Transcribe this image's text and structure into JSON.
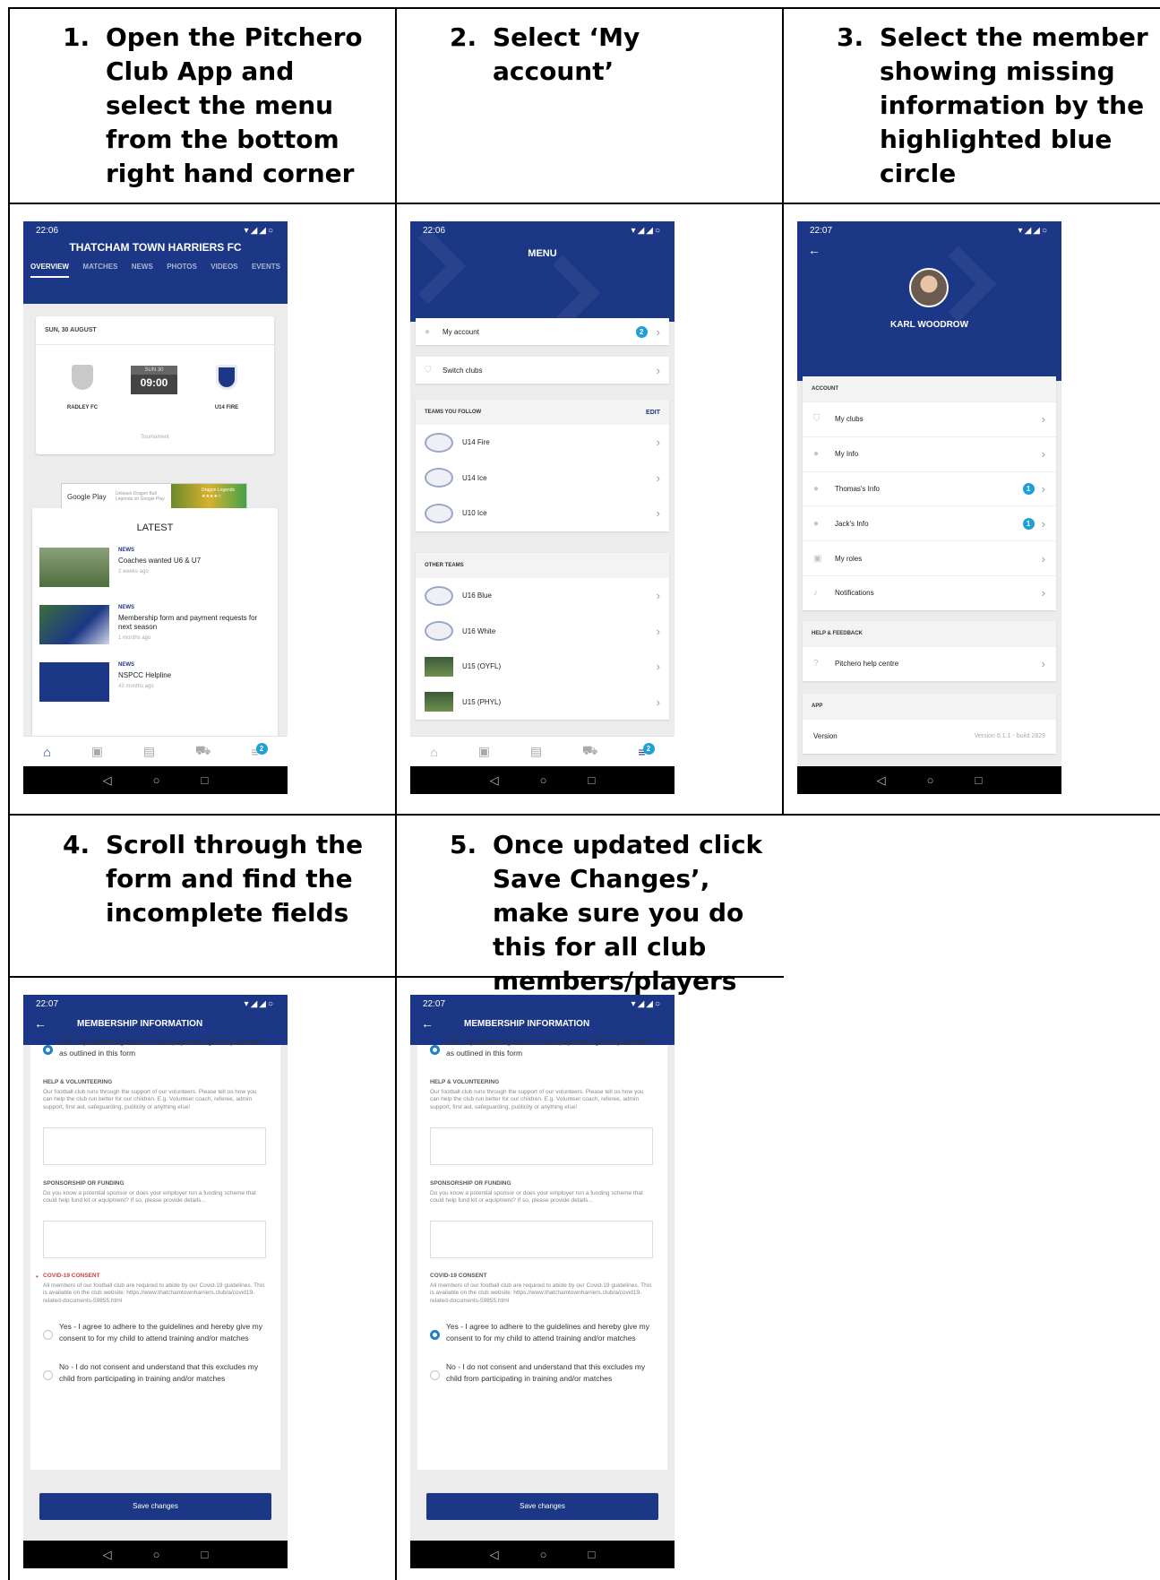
{
  "steps": [
    {
      "num": "1.",
      "text": "Open the Pitchero Club App and select the menu from the bottom right hand corner"
    },
    {
      "num": "2.",
      "text": "Select ‘My account’"
    },
    {
      "num": "3.",
      "text": "Select the member showing missing information by the highlighted blue circle"
    },
    {
      "num": "4.",
      "text": "Scroll through the form and find the incomplete fields"
    },
    {
      "num": "5.",
      "text": "Once updated click Save Changes’, make sure you do this for all club members/players"
    }
  ],
  "phone1": {
    "time": "22:06",
    "club_name": "THATCHAM TOWN HARRIERS FC",
    "tabs": [
      "OVERVIEW",
      "MATCHES",
      "NEWS",
      "PHOTOS",
      "VIDEOS",
      "EVENTS"
    ],
    "fixture_date": "SUN, 30 AUGUST",
    "home_team": "RADLEY FC",
    "away_team": "U14 FIRE",
    "kickoff_date": "SUN 30",
    "kickoff_time": "09:00",
    "competition": "Tournament",
    "ad_store": "Google Play",
    "ad_text": "Unleash Dragon Ball Legends on Google Play",
    "ad_brand": "Dragon Legends",
    "ad_rating": "★★★★☆",
    "latest_title": "LATEST",
    "news": [
      {
        "tag": "NEWS",
        "title": "Coaches wanted U6 & U7",
        "ago": "2 weeks ago"
      },
      {
        "tag": "NEWS",
        "title": "Membership form and payment requests for next season",
        "ago": "1 months ago"
      },
      {
        "tag": "NEWS",
        "title": "NSPCC Helpline",
        "ago": "43 months ago"
      }
    ],
    "menu_badge": "2"
  },
  "phone2": {
    "time": "22:06",
    "title": "MENU",
    "my_account": "My account",
    "my_account_badge": "2",
    "switch_clubs": "Switch clubs",
    "teams_follow_header": "TEAMS YOU FOLLOW",
    "edit_label": "EDIT",
    "followed_teams": [
      "U14 Fire",
      "U14 Ice",
      "U10 Ice"
    ],
    "other_teams_header": "OTHER TEAMS",
    "other_teams": [
      "U16 Blue",
      "U16 White",
      "U15 (OYFL)",
      "U15 (PHYL)"
    ],
    "menu_badge": "2"
  },
  "phone3": {
    "time": "22:07",
    "name": "KARL WOODROW",
    "account_header": "ACCOUNT",
    "account_items": [
      "My clubs",
      "My Info",
      "Thomas's Info",
      "Jack's Info",
      "My roles",
      "Notifications"
    ],
    "badge_value": "1",
    "help_header": "HELP & FEEDBACK",
    "help_item": "Pitchero help centre",
    "app_header": "APP",
    "version_label": "Version",
    "version_value": "Version 6.1.1 - build 2829"
  },
  "form": {
    "time": "22:07",
    "title": "MEMBERSHIP INFORMATION",
    "consent_yes": "Yes - By submitting this form and payment I give my consent as outlined in this form",
    "help_header": "HELP & VOLUNTEERING",
    "help_desc": "Our football club runs through the support of our volunteers. Please tell us how you can help the club run better for our children. E.g. Volunteer coach, referee, admin support, first aid, safeguarding, publicity or anything else!",
    "sponsor_header": "SPONSORSHIP OR FUNDING",
    "sponsor_desc": "Do you know a potential sponsor or does your employer run a funding scheme that could help fund kit or equipment? If so, please provide details...",
    "covid_header": "COVID-19 CONSENT",
    "covid_desc": "All members of our football club are required to abide by our Covid-19 guidelines. This is available on the club website: https://www.thatchamtownharriers.club/a/covid19-related-documents-59855.html",
    "covid_yes": "Yes - I agree to adhere to the guidelines and hereby give my consent to for my child to attend training and/or matches",
    "covid_no": "No - I do not consent and understand that this excludes my child from participating in training and/or matches",
    "save_label": "Save changes"
  },
  "colors": {
    "brand": "#1c3785",
    "badge": "#1f9fd8",
    "required": "#d04040"
  }
}
